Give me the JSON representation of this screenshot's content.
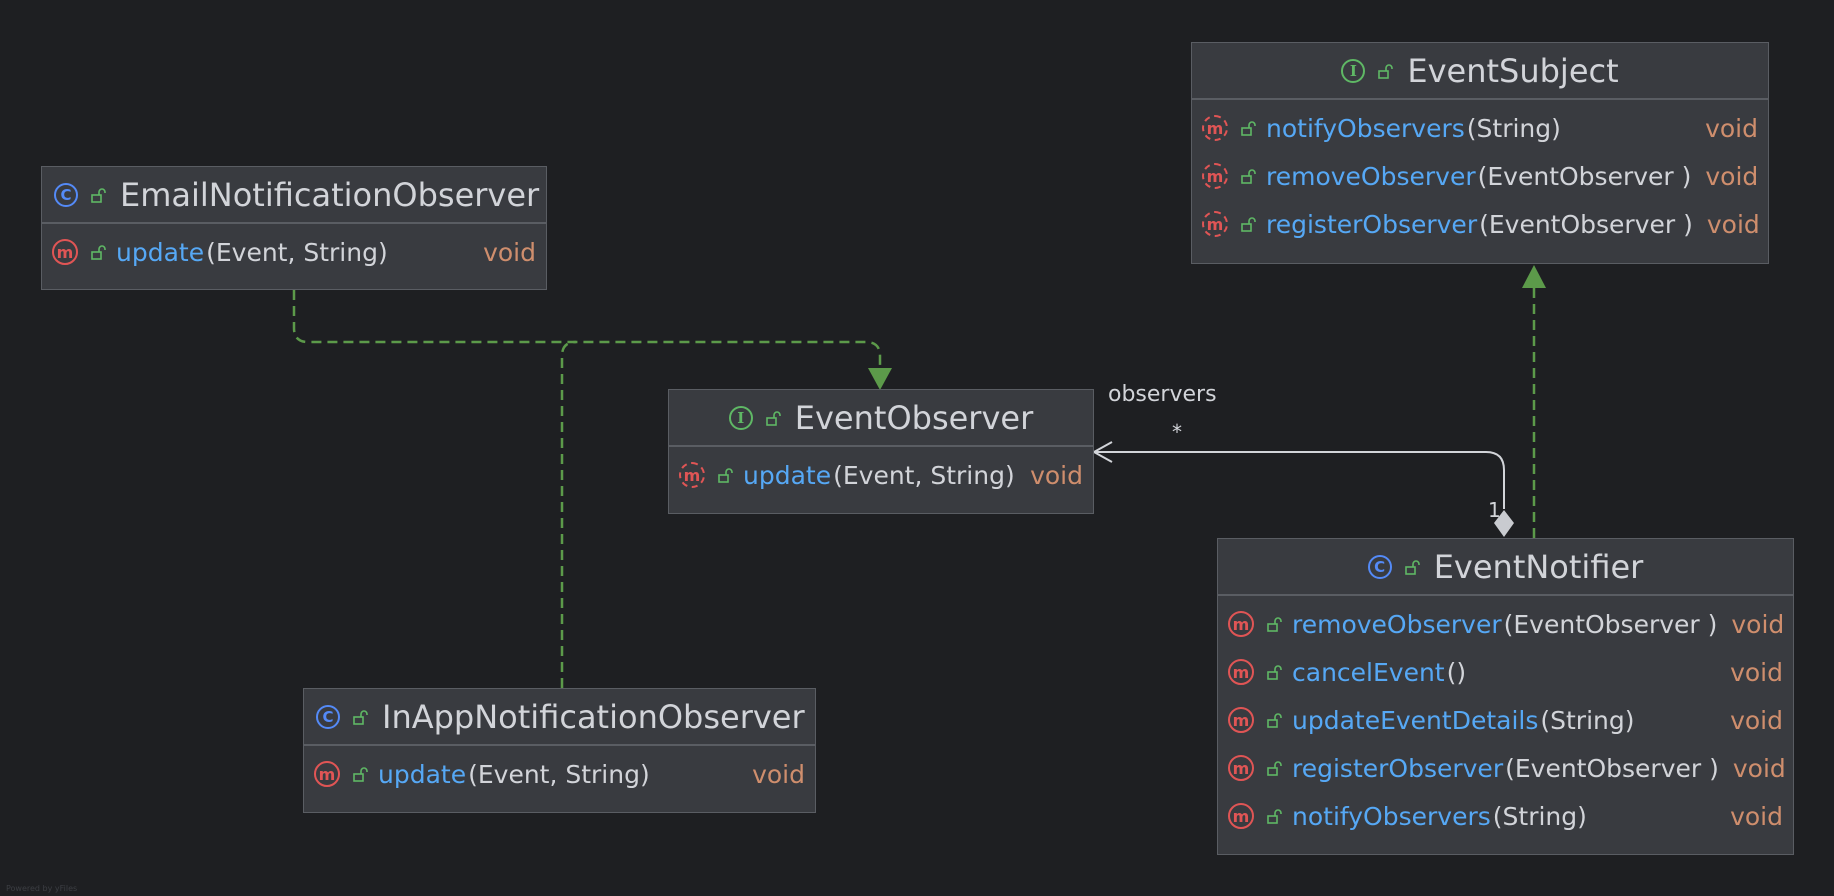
{
  "diagram": {
    "nodes": {
      "event_subject": {
        "kind": "I",
        "name": "EventSubject",
        "methods": [
          {
            "name": "notifyObservers",
            "params": "(String)",
            "returns": "void"
          },
          {
            "name": "removeObserver",
            "params": "(EventObserver )",
            "returns": "void"
          },
          {
            "name": "registerObserver",
            "params": "(EventObserver )",
            "returns": "void"
          }
        ]
      },
      "email_observer": {
        "kind": "C",
        "name": "EmailNotificationObserver",
        "methods": [
          {
            "name": "update",
            "params": "(Event, String)",
            "returns": "void"
          }
        ]
      },
      "event_observer": {
        "kind": "I",
        "name": "EventObserver",
        "methods": [
          {
            "name": "update",
            "params": "(Event, String)",
            "returns": "void"
          }
        ]
      },
      "inapp_observer": {
        "kind": "C",
        "name": "InAppNotificationObserver",
        "methods": [
          {
            "name": "update",
            "params": "(Event, String)",
            "returns": "void"
          }
        ]
      },
      "event_notifier": {
        "kind": "C",
        "name": "EventNotifier",
        "methods": [
          {
            "name": "removeObserver",
            "params": "(EventObserver )",
            "returns": "void"
          },
          {
            "name": "cancelEvent",
            "params": "()",
            "returns": "void"
          },
          {
            "name": "updateEventDetails",
            "params": "(String)",
            "returns": "void"
          },
          {
            "name": "registerObserver",
            "params": "(EventObserver )",
            "returns": "void"
          },
          {
            "name": "notifyObservers",
            "params": "(String)",
            "returns": "void"
          }
        ]
      }
    },
    "edges": {
      "association": {
        "label": "observers",
        "target_multiplicity": "*",
        "source_multiplicity": "1"
      }
    },
    "footer": "Powered by yFiles"
  },
  "colors": {
    "background": "#1e1f22",
    "node_fill": "#393b40",
    "node_border": "#5a5d63",
    "realization_edge": "#5c9a4a",
    "association_edge": "#d2d4d9",
    "method_name": "#56a8f5",
    "return_type": "#cf8e6d",
    "class_icon": "#548af7",
    "interface_icon": "#5fb865",
    "method_icon": "#e05555"
  },
  "icons": {
    "class": "class-c-icon",
    "interface": "interface-i-icon",
    "method": "method-m-icon",
    "visibility": "public-unlock-icon"
  }
}
